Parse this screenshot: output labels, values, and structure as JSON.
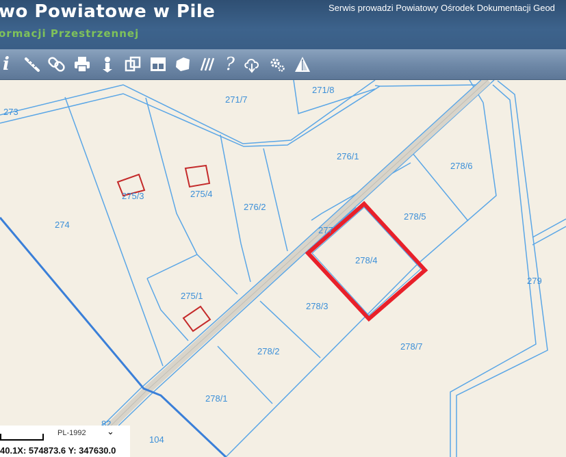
{
  "header": {
    "title": "wo Powiatowe w Pile",
    "subtitle": "ormacji Przestrzennej",
    "service_text": "Serwis prowadzi Powiatowy Ośrodek Dokumentacji Geod"
  },
  "toolbar": {
    "tools": [
      {
        "name": "info-tool",
        "icon": "info-icon"
      },
      {
        "name": "measure-tool",
        "icon": "ruler-icon"
      },
      {
        "name": "link-tool",
        "icon": "link-icon"
      },
      {
        "name": "print-tool",
        "icon": "printer-icon"
      },
      {
        "name": "identify-tool",
        "icon": "identify-icon"
      },
      {
        "name": "layers-tool",
        "icon": "layers-icon"
      },
      {
        "name": "layout-tool",
        "icon": "layout-icon"
      },
      {
        "name": "area-tool",
        "icon": "area-icon"
      },
      {
        "name": "hatch-tool",
        "icon": "hatch-icon"
      },
      {
        "name": "help-tool",
        "icon": "help-icon"
      },
      {
        "name": "download-tool",
        "icon": "cloud-download-icon"
      },
      {
        "name": "settings-tool",
        "icon": "gear-icon"
      },
      {
        "name": "warning-tool",
        "icon": "warning-icon"
      }
    ]
  },
  "map": {
    "parcel_labels": [
      "273",
      "271/7",
      "271/8",
      "276/1",
      "278/6",
      "275/3",
      "275/4",
      "276/2",
      "274",
      "278/5",
      "277",
      "278/4",
      "279",
      "275/1",
      "278/3",
      "278/2",
      "278/7",
      "278/1",
      "82",
      "104"
    ],
    "colors": {
      "background": "#f4efe4",
      "parcel_line": "#5aa6e6",
      "label": "#3b8fd8",
      "building": "#c42a2a",
      "highlight": "#e8202a",
      "boundary": "#3a7fd8",
      "road": "#d6d2c8"
    }
  },
  "status": {
    "crs": "PL-1992",
    "coordinates": "40.1X: 574873.6 Y: 347630.0"
  }
}
